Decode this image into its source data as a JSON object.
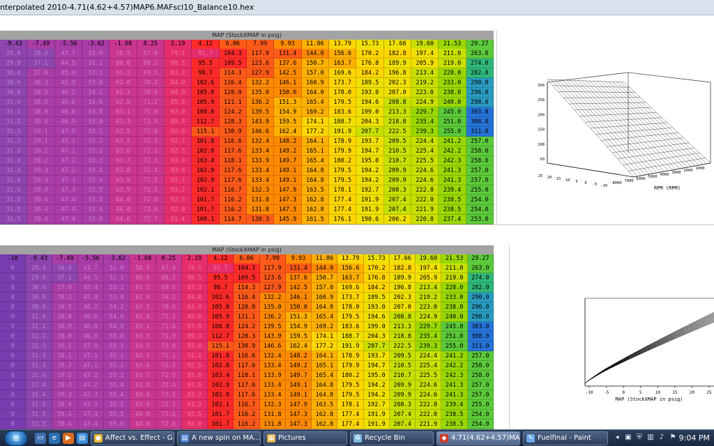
{
  "window": {
    "title": "nterpolated 2010-4.71(4.62+4.57)MAP6.MAFscl10_Balance10.hex"
  },
  "top_table": {
    "caption": "MAP (StockXMAP in psig)",
    "footer": "%",
    "map_headers": [
      "-9.43",
      "-7.49",
      "-5.56",
      "-3.62",
      "-1.68",
      "0.25",
      "2.19",
      "4.12",
      "6.06",
      "7.99",
      "9.93",
      "11.86",
      "13.79",
      "15.73",
      "17.66",
      "19.60",
      "21.53",
      "29.27"
    ],
    "rows": [
      [
        "29.4",
        "36.4",
        "43.7",
        "51.0",
        "58.9",
        "67.0",
        "79.1",
        "91.7",
        "104.3",
        "117.9",
        "131.4",
        "144.0",
        "156.6",
        "170.2",
        "182.8",
        "197.4",
        "211.0",
        "263.0"
      ],
      [
        "29.9",
        "37.1",
        "44.5",
        "52.1",
        "60.0",
        "68.2",
        "80.5",
        "95.5",
        "109.5",
        "123.6",
        "137.6",
        "150.7",
        "163.7",
        "176.8",
        "189.9",
        "205.9",
        "219.0",
        "274.0"
      ],
      [
        "30.4",
        "37.9",
        "45.4",
        "53.1",
        "61.2",
        "69.5",
        "83.3",
        "98.7",
        "114.3",
        "127.9",
        "142.5",
        "157.0",
        "169.6",
        "184.2",
        "196.8",
        "213.4",
        "228.0",
        "282.0"
      ],
      [
        "30.6",
        "38.3",
        "45.9",
        "53.8",
        "62.0",
        "70.2",
        "84.0",
        "102.6",
        "116.4",
        "132.2",
        "146.1",
        "160.9",
        "173.7",
        "189.5",
        "202.3",
        "219.2",
        "233.0",
        "290.0"
      ],
      [
        "30.8",
        "38.5",
        "46.2",
        "54.2",
        "62.3",
        "70.6",
        "84.9",
        "105.0",
        "120.0",
        "135.0",
        "150.0",
        "164.0",
        "178.0",
        "193.0",
        "207.0",
        "223.0",
        "238.0",
        "296.0"
      ],
      [
        "31.0",
        "38.8",
        "46.6",
        "54.6",
        "62.8",
        "71.2",
        "85.6",
        "105.9",
        "121.1",
        "136.2",
        "151.3",
        "165.4",
        "179.5",
        "194.6",
        "208.8",
        "224.9",
        "240.0",
        "298.0"
      ],
      [
        "31.1",
        "38.9",
        "46.8",
        "54.8",
        "63.1",
        "71.6",
        "87.0",
        "108.8",
        "124.2",
        "139.5",
        "154.9",
        "169.2",
        "183.6",
        "199.0",
        "213.3",
        "229.7",
        "245.0",
        "303.0"
      ],
      [
        "31.2",
        "39.0",
        "46.9",
        "55.0",
        "63.3",
        "71.9",
        "89.3",
        "112.7",
        "128.3",
        "143.9",
        "159.5",
        "174.1",
        "188.7",
        "204.3",
        "218.8",
        "235.4",
        "251.0",
        "308.0"
      ],
      [
        "31.3",
        "39.1",
        "47.0",
        "55.1",
        "63.5",
        "72.0",
        "92.0",
        "115.1",
        "130.9",
        "146.6",
        "162.4",
        "177.2",
        "191.9",
        "207.7",
        "222.5",
        "239.3",
        "255.0",
        "311.0"
      ],
      [
        "31.3",
        "39.1",
        "47.1",
        "55.2",
        "63.5",
        "72.1",
        "92.1",
        "101.8",
        "116.6",
        "132.4",
        "148.2",
        "164.1",
        "178.9",
        "193.7",
        "209.5",
        "224.4",
        "241.2",
        "257.0"
      ],
      [
        "31.3",
        "39.2",
        "47.1",
        "55.2",
        "63.6",
        "72.2",
        "92.5",
        "102.8",
        "117.6",
        "133.4",
        "149.2",
        "165.1",
        "179.9",
        "194.7",
        "210.5",
        "225.4",
        "242.2",
        "258.0"
      ],
      [
        "31.4",
        "39.2",
        "47.2",
        "55.3",
        "63.7",
        "72.3",
        "93.0",
        "103.4",
        "118.1",
        "133.9",
        "149.7",
        "165.4",
        "180.2",
        "195.0",
        "210.7",
        "225.5",
        "242.3",
        "258.0"
      ],
      [
        "31.4",
        "39.3",
        "47.2",
        "55.4",
        "63.8",
        "72.4",
        "93.6",
        "102.9",
        "117.6",
        "133.4",
        "149.1",
        "164.8",
        "179.5",
        "194.2",
        "209.9",
        "224.6",
        "241.3",
        "257.0"
      ],
      [
        "31.4",
        "39.3",
        "47.3",
        "55.4",
        "63.9",
        "72.5",
        "93.7",
        "102.9",
        "117.6",
        "133.4",
        "149.1",
        "164.8",
        "179.5",
        "194.2",
        "209.9",
        "224.6",
        "241.3",
        "257.0"
      ],
      [
        "31.5",
        "39.4",
        "47.3",
        "55.5",
        "63.9",
        "72.5",
        "93.2",
        "102.1",
        "116.7",
        "132.3",
        "147.9",
        "163.5",
        "178.1",
        "192.7",
        "208.3",
        "222.8",
        "239.4",
        "255.0"
      ],
      [
        "31.5",
        "39.4",
        "47.4",
        "55.5",
        "64.0",
        "72.6",
        "92.5",
        "101.7",
        "116.2",
        "131.8",
        "147.3",
        "162.8",
        "177.4",
        "191.9",
        "207.4",
        "222.0",
        "238.5",
        "254.0"
      ],
      [
        "31.5",
        "39.4",
        "47.4",
        "55.6",
        "64.0",
        "72.6",
        "92.0",
        "101.7",
        "116.2",
        "131.8",
        "147.3",
        "162.8",
        "177.4",
        "191.9",
        "207.4",
        "221.9",
        "238.5",
        "254.0"
      ],
      [
        "31.5",
        "39.4",
        "47.4",
        "55.6",
        "64.0",
        "72.7",
        "91.4",
        "100.1",
        "114.7",
        "130.3",
        "145.9",
        "161.5",
        "176.1",
        "190.6",
        "206.2",
        "220.8",
        "237.4",
        "253.0"
      ],
      [
        "31.5",
        "39.4",
        "47.4",
        "55.6",
        "64.0",
        "72.7",
        "91.3",
        "100.1",
        "114.7",
        "130.3",
        "145.9",
        "161.5",
        "176.1",
        "190.6",
        "206.2",
        "220.8",
        "237.4",
        "253.0"
      ]
    ]
  },
  "bottom_table": {
    "caption": "MAP (StockXMAP in psig)",
    "map_headers": [
      "-10",
      "-9.43",
      "-7.49",
      "-5.56",
      "-3.62",
      "-1.68",
      "0.25",
      "2.19",
      "4.12",
      "6.06",
      "7.99",
      "9.93",
      "11.86",
      "13.79",
      "15.73",
      "17.66",
      "19.60",
      "21.53",
      "29.27"
    ],
    "rows": [
      [
        "0",
        "29.4",
        "36.4",
        "43.7",
        "51.0",
        "58.9",
        "67.0",
        "79.1",
        "91.7",
        "104.3",
        "117.9",
        "131.4",
        "144.0",
        "156.6",
        "170.2",
        "182.8",
        "197.4",
        "211.0",
        "263.0"
      ],
      [
        "0",
        "29.9",
        "37.1",
        "44.5",
        "52.1",
        "60.0",
        "68.2",
        "80.5",
        "95.5",
        "109.5",
        "123.6",
        "137.6",
        "150.7",
        "163.7",
        "176.8",
        "189.9",
        "205.9",
        "219.0",
        "274.0"
      ],
      [
        "0",
        "30.4",
        "37.9",
        "45.4",
        "53.1",
        "61.2",
        "69.5",
        "83.3",
        "98.7",
        "114.3",
        "127.9",
        "142.5",
        "157.0",
        "169.6",
        "184.2",
        "196.8",
        "213.4",
        "228.0",
        "282.0"
      ],
      [
        "0",
        "30.6",
        "38.3",
        "45.9",
        "53.8",
        "62.0",
        "70.2",
        "84.0",
        "102.6",
        "116.4",
        "132.2",
        "146.1",
        "160.9",
        "173.7",
        "189.5",
        "202.3",
        "219.2",
        "233.0",
        "290.0"
      ],
      [
        "0",
        "30.8",
        "38.5",
        "46.2",
        "54.2",
        "62.3",
        "70.6",
        "84.9",
        "105.0",
        "120.0",
        "135.0",
        "150.0",
        "164.0",
        "178.0",
        "193.0",
        "207.0",
        "223.0",
        "238.0",
        "296.0"
      ],
      [
        "0",
        "31.0",
        "38.8",
        "46.6",
        "54.6",
        "62.8",
        "71.2",
        "85.6",
        "105.9",
        "121.1",
        "136.2",
        "151.3",
        "165.4",
        "179.5",
        "194.6",
        "208.8",
        "224.9",
        "240.0",
        "298.0"
      ],
      [
        "0",
        "31.1",
        "38.9",
        "46.8",
        "54.8",
        "63.1",
        "71.6",
        "87.0",
        "108.8",
        "124.2",
        "139.5",
        "154.9",
        "169.2",
        "183.6",
        "199.0",
        "213.3",
        "229.7",
        "245.0",
        "303.0"
      ],
      [
        "0",
        "31.2",
        "39.0",
        "46.9",
        "55.0",
        "63.3",
        "71.9",
        "89.3",
        "112.7",
        "128.3",
        "143.9",
        "159.5",
        "174.1",
        "188.7",
        "204.3",
        "218.8",
        "235.4",
        "251.0",
        "308.0"
      ],
      [
        "0",
        "31.3",
        "39.1",
        "47.0",
        "55.1",
        "63.5",
        "72.0",
        "92.0",
        "115.1",
        "130.9",
        "146.6",
        "162.4",
        "177.2",
        "191.9",
        "207.7",
        "222.5",
        "239.3",
        "255.0",
        "311.0"
      ],
      [
        "0",
        "31.3",
        "39.1",
        "47.1",
        "55.2",
        "63.5",
        "72.1",
        "92.1",
        "101.8",
        "116.6",
        "132.4",
        "148.2",
        "164.1",
        "178.9",
        "193.7",
        "209.5",
        "224.4",
        "241.2",
        "257.0"
      ],
      [
        "0",
        "31.3",
        "39.2",
        "47.1",
        "55.2",
        "63.6",
        "72.2",
        "92.5",
        "102.8",
        "117.6",
        "133.4",
        "149.2",
        "165.1",
        "179.9",
        "194.7",
        "210.5",
        "225.4",
        "242.2",
        "258.0"
      ],
      [
        "0",
        "31.4",
        "39.2",
        "47.2",
        "55.3",
        "63.7",
        "72.3",
        "93.0",
        "103.4",
        "118.1",
        "133.9",
        "149.7",
        "165.4",
        "180.2",
        "195.0",
        "210.7",
        "225.5",
        "242.3",
        "258.0"
      ],
      [
        "0",
        "31.4",
        "39.3",
        "47.2",
        "55.4",
        "63.8",
        "72.4",
        "93.6",
        "102.9",
        "117.6",
        "133.4",
        "149.1",
        "164.8",
        "179.5",
        "194.2",
        "209.9",
        "224.6",
        "241.3",
        "257.0"
      ],
      [
        "0",
        "31.4",
        "39.3",
        "47.3",
        "55.4",
        "63.9",
        "72.5",
        "93.7",
        "102.9",
        "117.6",
        "133.4",
        "149.1",
        "164.8",
        "179.5",
        "194.2",
        "209.9",
        "224.6",
        "241.3",
        "257.0"
      ],
      [
        "0",
        "31.5",
        "39.4",
        "47.3",
        "55.5",
        "63.9",
        "72.5",
        "93.2",
        "102.1",
        "116.7",
        "132.3",
        "147.9",
        "163.5",
        "178.1",
        "192.7",
        "208.3",
        "222.8",
        "239.4",
        "255.0"
      ],
      [
        "0",
        "31.5",
        "39.4",
        "47.4",
        "55.5",
        "64.0",
        "72.6",
        "92.5",
        "101.7",
        "116.2",
        "131.8",
        "147.3",
        "162.8",
        "177.4",
        "191.9",
        "207.4",
        "222.0",
        "238.5",
        "254.0"
      ],
      [
        "0",
        "31.5",
        "39.4",
        "47.4",
        "55.6",
        "64.0",
        "72.6",
        "92.0",
        "101.7",
        "116.2",
        "131.8",
        "147.3",
        "162.8",
        "177.4",
        "191.9",
        "207.4",
        "221.9",
        "238.5",
        "254.0"
      ],
      [
        "0",
        "31.5",
        "39.4",
        "47.4",
        "55.6",
        "64.0",
        "72.7",
        "91.4",
        "100.1",
        "114.7",
        "130.3",
        "145.9",
        "161.5",
        "176.1",
        "190.6",
        "206.2",
        "220.8",
        "237.4",
        "253.0"
      ],
      [
        "0",
        "31.5",
        "39.4",
        "47.4",
        "55.6",
        "64.0",
        "72.7",
        "91.3",
        "100.1",
        "114.7",
        "130.3",
        "145.9",
        "161.5",
        "176.1",
        "190.6",
        "206.2",
        "220.8",
        "237.4",
        "253.0"
      ]
    ]
  },
  "graph3d": {
    "z_ticks": [
      "300",
      "250",
      "200",
      "150",
      "100",
      "50"
    ],
    "map_ticks": [
      "25",
      "20",
      "15",
      "10",
      "5",
      "0",
      "-5",
      "-10"
    ],
    "rpm_ticks": [
      "8000",
      "7000",
      "6000",
      "5000",
      "4000",
      "3000",
      "2000",
      "1000"
    ],
    "rpm_label": "RPM (RPM)"
  },
  "graph2d": {
    "x_ticks": [
      "-10",
      "-5",
      "0",
      "5",
      "10",
      "15",
      "20",
      "25"
    ],
    "x_label": "MAP (StockXMAP in psig)"
  },
  "taskbar": {
    "buttons": [
      {
        "label": "Affect vs. Effect - G...",
        "icon": "chrome-icon"
      },
      {
        "label": "A new spin on MA...",
        "icon": "document-icon"
      },
      {
        "label": "Pictures",
        "icon": "folder-icon"
      },
      {
        "label": "Recycle Bin",
        "icon": "recycle-bin-icon"
      },
      {
        "label": "4.71(4.62+4.57)MA...",
        "icon": "tuner-app-icon"
      },
      {
        "label": "Fuelfinal - Paint",
        "icon": "paint-icon"
      }
    ],
    "clock": "9:04 PM"
  },
  "colors": {
    "scale": [
      "#7a3db0",
      "#8e44ad",
      "#a93ca6",
      "#c8368f",
      "#e52d6b",
      "#ff2a2a",
      "#ff5a1a",
      "#ff8a00",
      "#ffb000",
      "#ffd500",
      "#f0e000",
      "#c8e000",
      "#98d800",
      "#5cc93a",
      "#2fb87a",
      "#2a9bc0",
      "#2673d8"
    ]
  }
}
